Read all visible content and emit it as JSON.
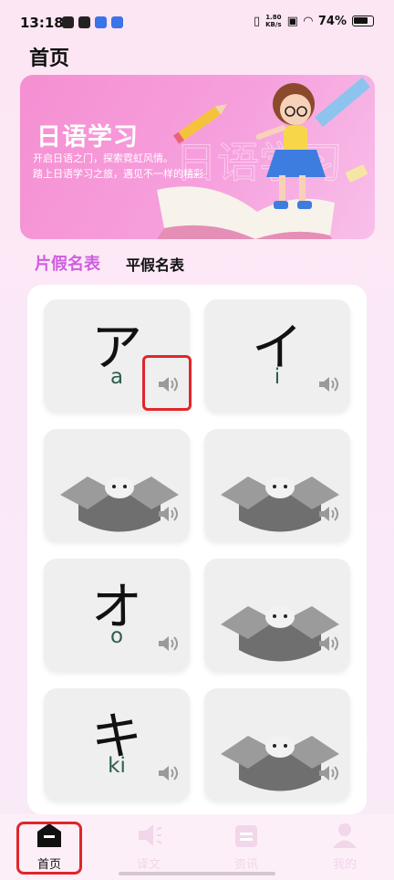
{
  "status_bar": {
    "time": "13:18",
    "net_speed_value": "1.80",
    "net_speed_unit": "KB/s",
    "battery": "74%"
  },
  "header": {
    "title": "首页"
  },
  "banner": {
    "title": "日语学习",
    "subtitle_line1": "开启日语之门，探索霓虹风情。",
    "subtitle_line2": "踏上日语学习之旅，遇见不一样的精彩"
  },
  "tabs": [
    {
      "label": "片假名表",
      "active": true
    },
    {
      "label": "平假名表",
      "active": false
    }
  ],
  "cards": [
    {
      "kana": "ア",
      "romaji": "a",
      "locked": false
    },
    {
      "kana": "イ",
      "romaji": "i",
      "locked": false
    },
    {
      "kana": "",
      "romaji": "",
      "locked": true
    },
    {
      "kana": "",
      "romaji": "",
      "locked": true
    },
    {
      "kana": "オ",
      "romaji": "o",
      "locked": false
    },
    {
      "kana": "",
      "romaji": "",
      "locked": true
    },
    {
      "kana": "キ",
      "romaji": "ki",
      "locked": false
    },
    {
      "kana": "",
      "romaji": "",
      "locked": true
    }
  ],
  "icons": {
    "speaker": "speaker-icon",
    "locked_box": "mystery-box-icon"
  },
  "bottom_nav": [
    {
      "label": "首页",
      "icon": "home-icon",
      "active": true
    },
    {
      "label": "译文",
      "icon": "translate-icon",
      "active": false
    },
    {
      "label": "资讯",
      "icon": "news-icon",
      "active": false
    },
    {
      "label": "我的",
      "icon": "profile-icon",
      "active": false
    }
  ],
  "colors": {
    "accent": "#cf5ee0",
    "banner": "#f58fd2",
    "romaji": "#2e5e4e",
    "highlight": "#e0262a"
  }
}
